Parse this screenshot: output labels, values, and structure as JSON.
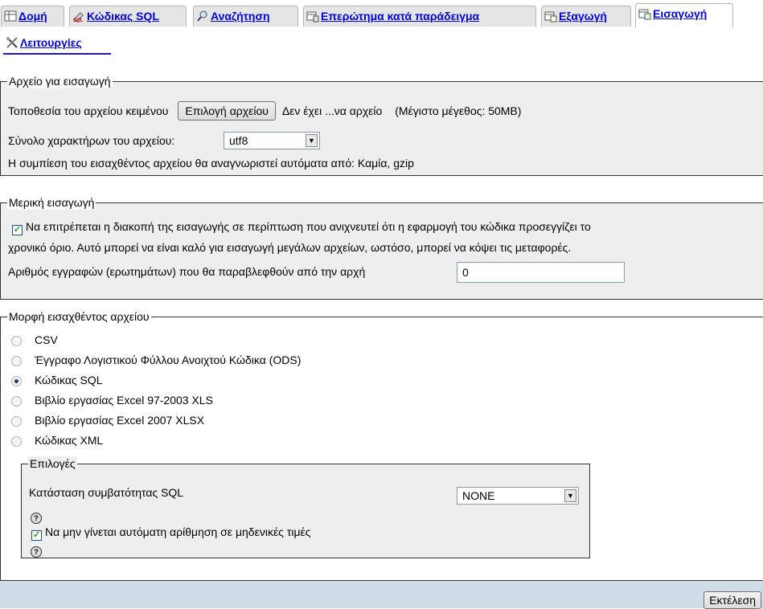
{
  "tabs": [
    {
      "label": "Δομή",
      "icon": "structure-icon"
    },
    {
      "label": "Κώδικας SQL",
      "icon": "sql-icon"
    },
    {
      "label": "Αναζήτηση",
      "icon": "search-icon"
    },
    {
      "label": "Επερώτημα κατά παράδειγμα",
      "icon": "query-icon"
    },
    {
      "label": "Εξαγωγή",
      "icon": "export-icon"
    },
    {
      "label": "Εισαγωγή",
      "icon": "import-icon",
      "active": true
    },
    {
      "label": "Λειτουργίες",
      "icon": "operations-icon"
    }
  ],
  "file_section": {
    "legend": "Αρχείο για εισαγωγή",
    "location_label": "Τοποθεσία του αρχείου κειμένου",
    "choose_button": "Επιλογή αρχείου",
    "no_file_text": "Δεν έχει ...να αρχείο",
    "max_size": "(Μέγιστο μέγεθος: 50MB)",
    "charset_label": "Σύνολο χαρακτήρων του αρχείου:",
    "charset_value": "utf8",
    "compression_note": "Η συμπίεση του εισαχθέντος αρχείου θα αναγνωριστεί αυτόματα από: Καμία, gzip"
  },
  "partial_section": {
    "legend": "Μερική εισαγωγή",
    "allow_interrupt_checked": true,
    "allow_interrupt_line1": "Να επιτρέπεται η διακοπή της εισαγωγής σε περίπτωση που ανιχνευτεί ότι η εφαρμογή του κώδικα προσεγγίζει το",
    "allow_interrupt_line2": "χρονικό όριο. Αυτό μπορεί να είναι καλό για εισαγωγή μεγάλων αρχείων, ωστόσο, μπορεί να κόψει τις μεταφορές.",
    "skip_label": "Αριθμός εγγραφών (ερωτημάτων) που θα παραβλεφθούν από την αρχή",
    "skip_value": "0"
  },
  "format_section": {
    "legend": "Μορφή εισαχθέντος αρχείου",
    "formats": [
      {
        "label": "CSV",
        "selected": false
      },
      {
        "label": "Έγγραφο Λογιστικού Φύλλου Ανοιχτού Κώδικα (ODS)",
        "selected": false
      },
      {
        "label": "Κώδικας SQL",
        "selected": true
      },
      {
        "label": "Βιβλίο εργασίας Excel 97-2003 XLS",
        "selected": false
      },
      {
        "label": "Βιβλίο εργασίας Excel 2007 XLSX",
        "selected": false
      },
      {
        "label": "Κώδικας XML",
        "selected": false
      }
    ],
    "options": {
      "legend": "Επιλογές",
      "compat_label": "Κατάσταση συμβατότητας SQL",
      "compat_value": "NONE",
      "no_auto_value_label": "Να μην γίνεται αυτόματη αρίθμηση σε μηδενικές τιμές",
      "no_auto_value_checked": true,
      "help_glyph": "?"
    }
  },
  "footer": {
    "submit_label": "Εκτέλεση"
  }
}
